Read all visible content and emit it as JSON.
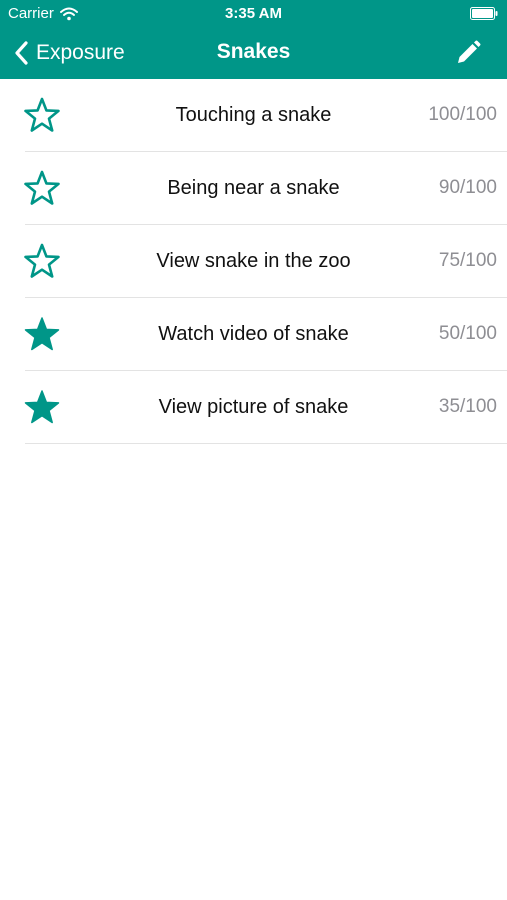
{
  "status_bar": {
    "carrier": "Carrier",
    "time": "3:35 AM",
    "wifi_icon": "wifi-icon",
    "battery_icon": "battery-icon"
  },
  "nav": {
    "back_label": "Exposure",
    "title": "Snakes",
    "back_icon": "chevron-left-icon",
    "edit_icon": "pencil-icon"
  },
  "colors": {
    "accent": "#009688",
    "score_gray": "#8e8e93",
    "divider": "#e3e3e3"
  },
  "items": [
    {
      "label": "Touching a snake",
      "score": "100/100",
      "star": "outline"
    },
    {
      "label": "Being near a snake",
      "score": "90/100",
      "star": "outline"
    },
    {
      "label": "View snake in the zoo",
      "score": "75/100",
      "star": "outline"
    },
    {
      "label": "Watch video of snake",
      "score": "50/100",
      "star": "filled"
    },
    {
      "label": "View picture of snake",
      "score": "35/100",
      "star": "filled"
    }
  ]
}
